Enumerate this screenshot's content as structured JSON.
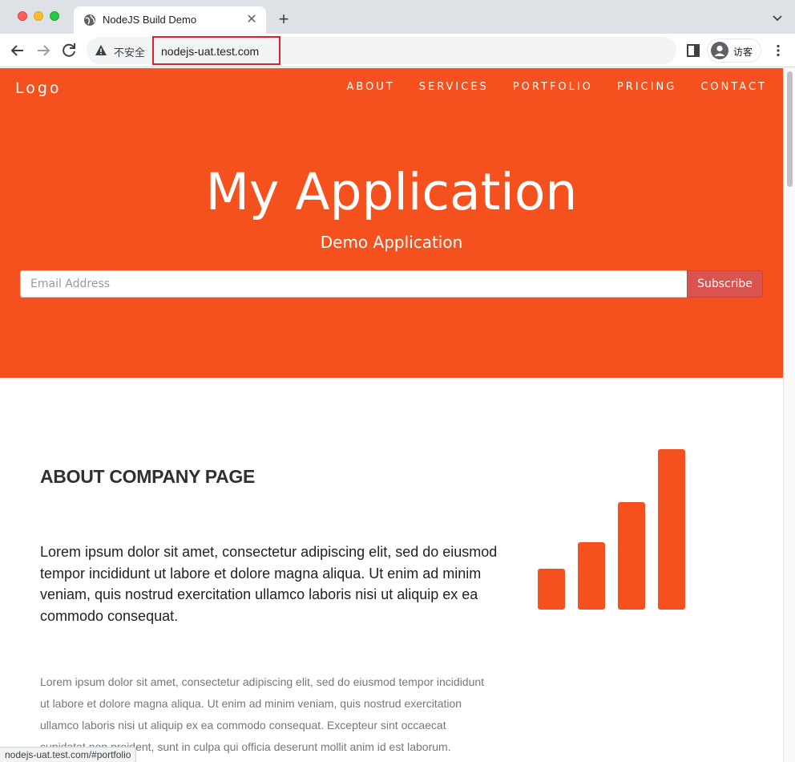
{
  "browser": {
    "tab_title": "NodeJS Build Demo",
    "insecure_label": "不安全",
    "url": "nodejs-uat.test.com",
    "profile_label": "访客",
    "status_url": "nodejs-uat.test.com/#portfolio"
  },
  "page": {
    "logo": "Logo",
    "nav": [
      "ABOUT",
      "SERVICES",
      "PORTFOLIO",
      "PRICING",
      "CONTACT"
    ],
    "hero_title": "My Application",
    "hero_subtitle": "Demo Application",
    "email_placeholder": "Email Address",
    "subscribe_label": "Subscribe",
    "about_heading": "ABOUT COMPANY PAGE",
    "about_lead": "Lorem ipsum dolor sit amet, consectetur adipiscing elit, sed do eiusmod tempor incididunt ut labore et dolore magna aliqua. Ut enim ad minim veniam, quis nostrud exercitation ullamco laboris nisi ut aliquip ex ea commodo consequat.",
    "about_body": "Lorem ipsum dolor sit amet, consectetur adipiscing elit, sed do eiusmod tempor incididunt ut labore et dolore magna aliqua. Ut enim ad minim veniam, quis nostrud exercitation ullamco laboris nisi ut aliquip ex ea commodo consequat. Excepteur sint occaecat cupidatat non proident, sunt in culpa qui officia deserunt mollit anim id est laborum.",
    "about_icon": "signal-bars-icon"
  },
  "colors": {
    "accent": "#f4511e",
    "subscribe": "#d9534f"
  }
}
